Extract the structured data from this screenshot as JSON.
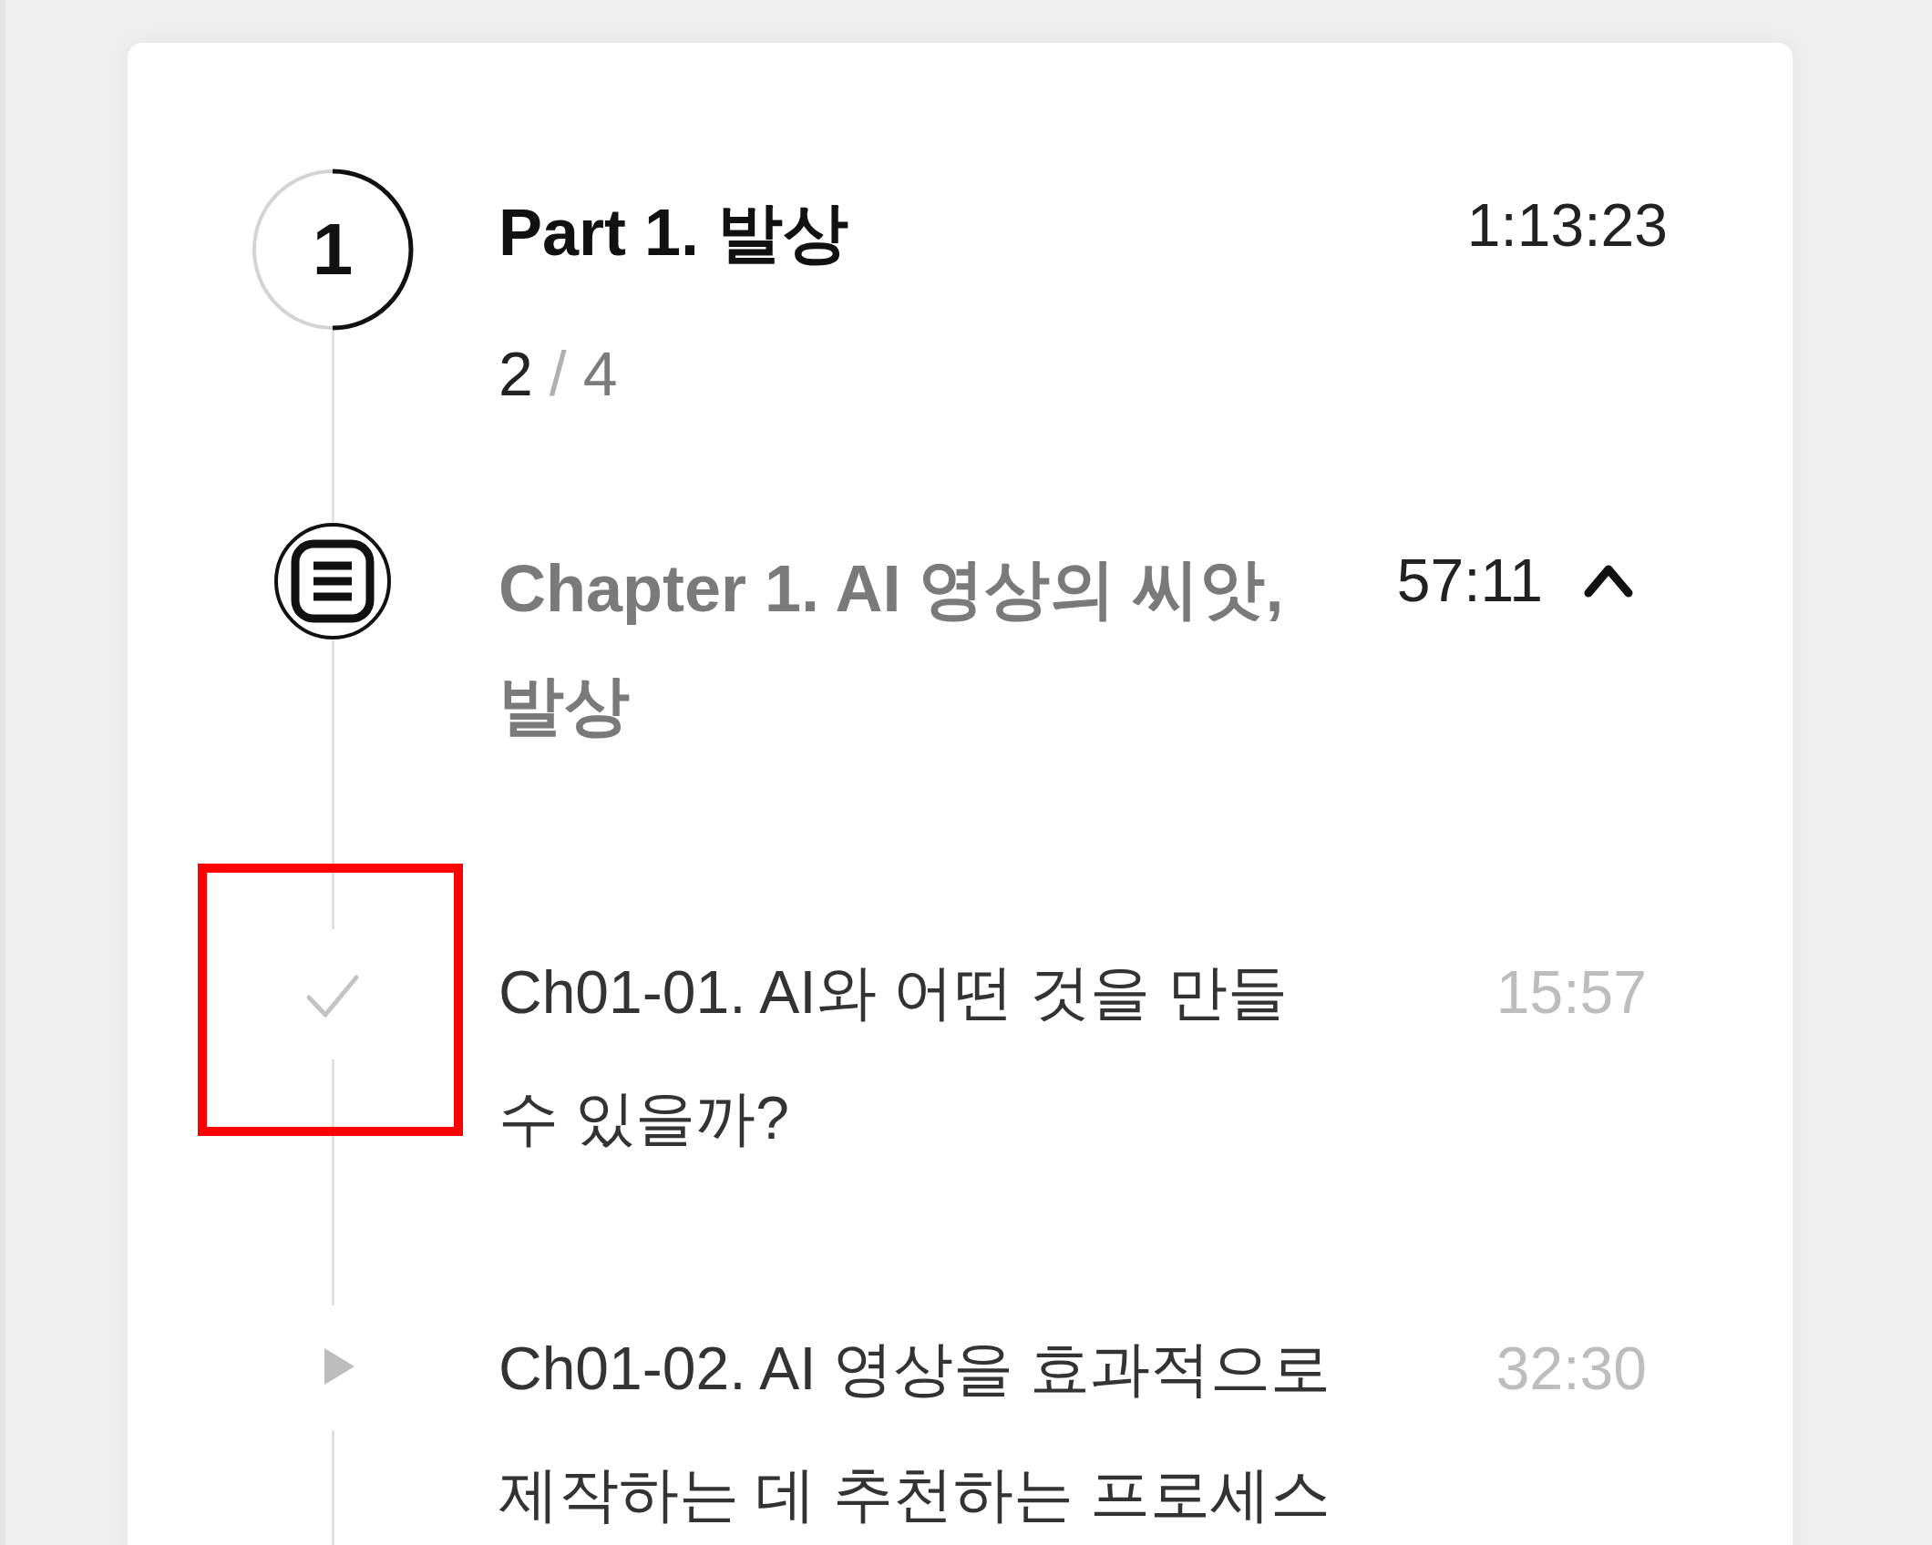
{
  "part": {
    "number": "1",
    "title": "Part 1. 발상",
    "duration": "1:13:23",
    "progress": {
      "done": "2",
      "separator": "/",
      "total": "4",
      "level": 0.5
    },
    "chapters": [
      {
        "title": "Chapter 1. AI 영상의 씨앗, 발상",
        "duration": "57:11",
        "expanded": true,
        "lessons": [
          {
            "title": "Ch01-01. AI와 어떤 것을 만들 수 있을까?",
            "duration": "15:57",
            "completed": true,
            "highlighted": true
          },
          {
            "title": "Ch01-02. AI 영상을 효과적으로 제작하는 데 추천하는 프로세스",
            "duration": "32:30",
            "completed": false,
            "highlighted": false
          }
        ]
      }
    ]
  }
}
